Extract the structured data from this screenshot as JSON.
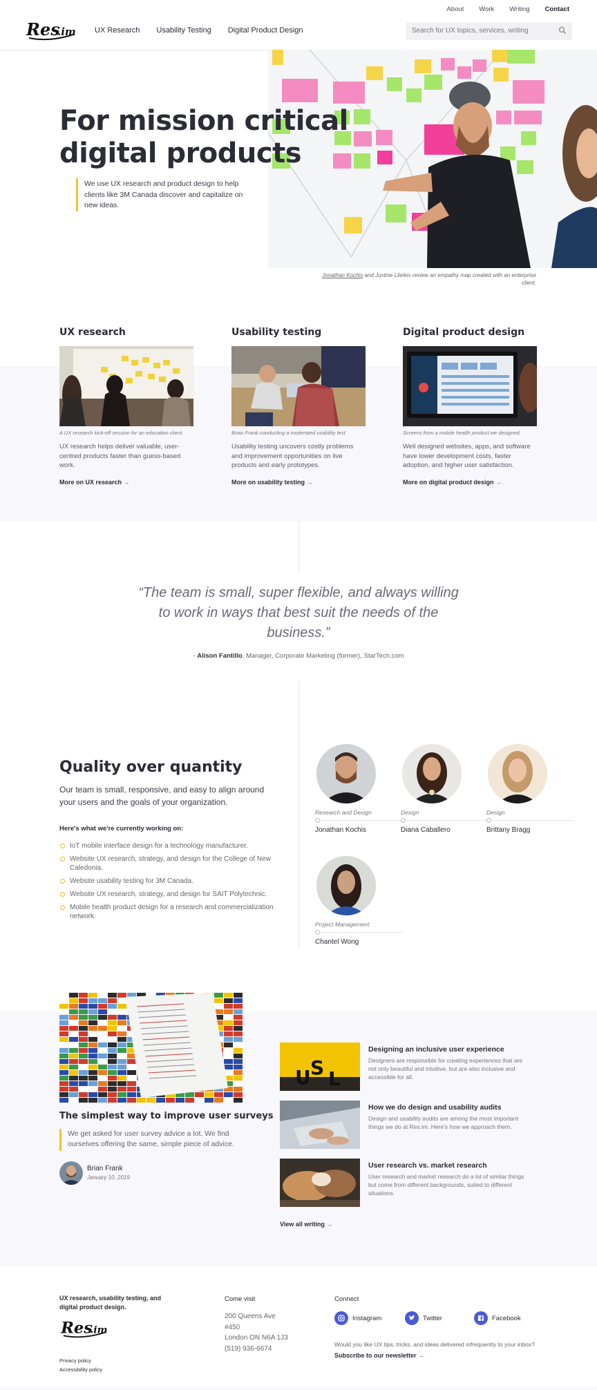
{
  "header": {
    "brand": "Res.im",
    "top_links": [
      "About",
      "Work",
      "Writing",
      "Contact"
    ],
    "main_links": [
      "UX Research",
      "Usability Testing",
      "Digital Product Design"
    ],
    "search_placeholder": "Search for UX topics, services, writing"
  },
  "hero": {
    "title_line1": "For mission critical",
    "title_line2": "digital products",
    "subtitle": "We use UX research and product design to help clients like 3M Canada discover and capitalize on new ideas.",
    "caption_name": "Jonathan Kochis",
    "caption_rest": " and Justine Lileikis review an empathy map created with an enterprise client."
  },
  "services": [
    {
      "title": "UX research",
      "caption": "A UX research kick-off session for an education client.",
      "description": "UX research helps deliver valuable, user-centred products faster than guess-based work.",
      "link": "More on UX research"
    },
    {
      "title": "Usability testing",
      "caption": "Brian Frank conducting a moderated usability test.",
      "description": "Usability testing uncovers costly problems and improvement opportunities on live products and early prototypes.",
      "link": "More on usability testing"
    },
    {
      "title": "Digital product design",
      "caption": "Screens from a mobile health product we designed.",
      "description": "Well designed websites, apps, and software have lower development costs, faster adoption, and higher user satisfaction.",
      "link": "More on digital product design"
    }
  ],
  "testimonial": {
    "quote": "“The team is small, super flexible, and always willing to work in ways that best suit the needs of the business.”",
    "prefix": "- ",
    "name": "Alison Fantillo",
    "role": ", Manager, Corporate Marketing (former), StarTech.com"
  },
  "team": {
    "title": "Quality over quantity",
    "lead": "Our team is small, responsive, and easy to align around your users and the goals of your organization.",
    "working_on_heading": "Here's what we're currently working on:",
    "working_on": [
      "IoT mobile interface design for a technology manufacturer.",
      "Website UX research, strategy, and design for the College of New Caledonia.",
      "Website usability testing for 3M Canada.",
      "Website UX research, strategy, and design for SAIT Polytechnic.",
      "Mobile health product design for a research and commercialization network."
    ],
    "members": [
      {
        "role": "Research and Design",
        "name": "Jonathan Kochis"
      },
      {
        "role": "Design",
        "name": "Diana Caballero"
      },
      {
        "role": "Design",
        "name": "Brittany Bragg"
      },
      {
        "role": "Project Management",
        "name": "Chantel Wong"
      }
    ]
  },
  "writing": {
    "featured": {
      "title": "The simplest way to improve user surveys",
      "excerpt": "We get asked for user survey advice a lot. We find ourselves offering the same, simple piece of advice.",
      "author": "Brian Frank",
      "date": "January 10, 2019"
    },
    "posts": [
      {
        "title": "Designing an inclusive user experience",
        "excerpt": "Designers are responsible for creating experiences that are not only beautiful and intuitive, but are also inclusive and accessible for all."
      },
      {
        "title": "How we do design and usability audits",
        "excerpt": "Design and usability audits are among the most important things we do at Res.im. Here's how we approach them."
      },
      {
        "title": "User research vs. market research",
        "excerpt": "User research and market research do a lot of similar things but come from different backgrounds, suited to different situations."
      }
    ],
    "view_all": "View all writing"
  },
  "footer": {
    "tagline": "UX research, usability testing, and digital product design.",
    "links": [
      "Privacy policy",
      "Accessibility policy"
    ],
    "visit_heading": "Come visit",
    "address": [
      "200 Queens Ave",
      "#450",
      "London ON N6A 1J3",
      "(519) 936-6674"
    ],
    "connect_heading": "Connect",
    "social": [
      "Instagram",
      "Twitter",
      "Facebook"
    ],
    "newsletter_question": "Would you like UX tips, tricks, and ideas delivered infrequently to your inbox?",
    "newsletter_link": "Subscribe to our newsletter"
  },
  "colors": {
    "accent": "#4a5bd4",
    "highlight": "#f1c232",
    "band": "#f7f7fc"
  },
  "icons": [
    "search-icon",
    "arrow-right-icon",
    "instagram-icon",
    "twitter-icon",
    "facebook-icon"
  ]
}
